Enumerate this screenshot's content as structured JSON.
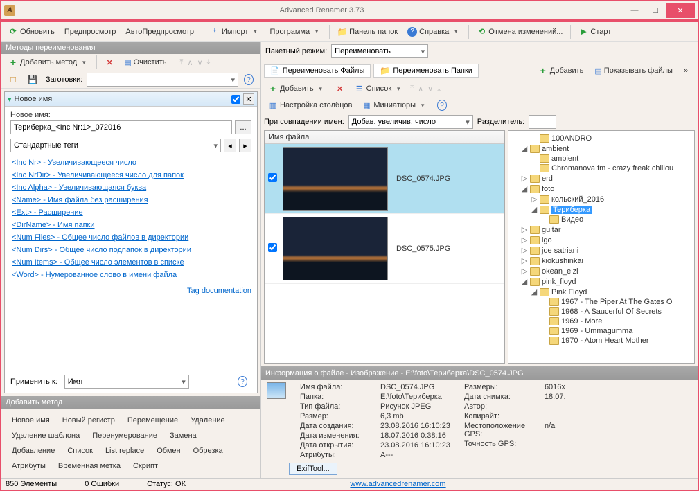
{
  "window": {
    "title": "Advanced Renamer 3.73"
  },
  "winbtns": {
    "min": "—",
    "max": "☐",
    "close": "✕"
  },
  "maintb": {
    "refresh": "Обновить",
    "preview": "Предпросмотр",
    "autopreview": "АвтоПредпросмотр",
    "import": "Импорт",
    "program": "Программа",
    "folderpanel": "Панель папок",
    "help": "Справка",
    "undo": "Отмена изменений...",
    "start": "Старт"
  },
  "left": {
    "hdr_methods": "Методы переименования",
    "add_method": "Добавить метод",
    "clear": "Очистить",
    "presets": "Заготовки:",
    "method_name": "Новое имя",
    "newname_lbl": "Новое имя:",
    "newname_val": "Териберка_<Inc Nr:1>_072016",
    "tags_lbl": "Стандартные теги",
    "tags": [
      "<Inc Nr> - Увеличивающееся число",
      "<Inc NrDir> - Увеличивающееся число для папок",
      "<Inc Alpha> - Увеличивающаяся буква",
      "<Name> - Имя файла без расширения",
      "<Ext> - Расширение",
      "<DirName> - Имя папки",
      "<Num Files> - Общее число файлов в директории",
      "<Num Dirs> - Общее число подпапок в директории",
      "<Num Items> - Общее число элементов в списке",
      "<Word> - Нумерованное слово в имени файла"
    ],
    "tagdoc": "Tag documentation",
    "applyto": "Применить к:",
    "applyto_val": "Имя",
    "hdr_add": "Добавить метод",
    "addm": {
      "r1": [
        "Новое имя",
        "Новый регистр",
        "Перемещение",
        "Удаление"
      ],
      "r2": [
        "Удаление шаблона",
        "Перенумерование",
        "Замена"
      ],
      "r3": [
        "Добавление",
        "Список",
        "List replace",
        "Обмен",
        "Обрезка"
      ],
      "r4": [
        "Атрибуты",
        "Временная метка",
        "Скрипт"
      ]
    }
  },
  "right": {
    "batch_lbl": "Пакетный режим:",
    "batch_val": "Переименовать",
    "tab_files": "Переименовать Файлы",
    "tab_folders": "Переименовать Папки",
    "add": "Добавить",
    "list": "Список",
    "cols": "Настройка столбцов",
    "thumbs": "Миниатюры",
    "collision_lbl": "При совпадении имен:",
    "collision_val": "Добав. увеличив. число",
    "separator_lbl": "Разделитель:",
    "fh_name": "Имя файла",
    "files": [
      "DSC_0574.JPG",
      "DSC_0575.JPG"
    ],
    "tree_add": "Добавить",
    "tree_show": "Показывать файлы",
    "tree": [
      {
        "ind": 2,
        "lbl": "100ANDRO",
        "tgl": ""
      },
      {
        "ind": 1,
        "lbl": "ambient",
        "tgl": "◢"
      },
      {
        "ind": 2,
        "lbl": "ambient",
        "tgl": ""
      },
      {
        "ind": 2,
        "lbl": "Chromanova.fm - crazy freak chillou",
        "tgl": ""
      },
      {
        "ind": 1,
        "lbl": "erd",
        "tgl": "▷"
      },
      {
        "ind": 1,
        "lbl": "foto",
        "tgl": "◢"
      },
      {
        "ind": 2,
        "lbl": "кольский_2016",
        "tgl": "▷"
      },
      {
        "ind": 2,
        "lbl": "Териберка",
        "tgl": "◢",
        "sel": true
      },
      {
        "ind": 3,
        "lbl": "Видео",
        "tgl": ""
      },
      {
        "ind": 1,
        "lbl": "guitar",
        "tgl": "▷"
      },
      {
        "ind": 1,
        "lbl": "igo",
        "tgl": "▷"
      },
      {
        "ind": 1,
        "lbl": "joe satriani",
        "tgl": "▷"
      },
      {
        "ind": 1,
        "lbl": "kiokushinkai",
        "tgl": "▷"
      },
      {
        "ind": 1,
        "lbl": "okean_elzi",
        "tgl": "▷"
      },
      {
        "ind": 1,
        "lbl": "pink_floyd",
        "tgl": "◢"
      },
      {
        "ind": 2,
        "lbl": "Pink Floyd",
        "tgl": "◢"
      },
      {
        "ind": 3,
        "lbl": "1967 - The Piper At The Gates O",
        "tgl": ""
      },
      {
        "ind": 3,
        "lbl": "1968 - A Saucerful Of Secrets",
        "tgl": ""
      },
      {
        "ind": 3,
        "lbl": "1969 - More",
        "tgl": ""
      },
      {
        "ind": 3,
        "lbl": "1969 - Ummagumma",
        "tgl": ""
      },
      {
        "ind": 3,
        "lbl": "1970 - Atom Heart Mother",
        "tgl": ""
      }
    ]
  },
  "info": {
    "hdr": "Информация о файле - Изображение - E:\\foto\\Териберка\\DSC_0574.JPG",
    "left": [
      [
        "Имя файла:",
        "DSC_0574.JPG"
      ],
      [
        "Папка:",
        "E:\\foto\\Териберка"
      ],
      [
        "Тип файла:",
        "Рисунок JPEG"
      ],
      [
        "Размер:",
        "6,3 mb"
      ],
      [
        "Дата создания:",
        "23.08.2016 16:10:23"
      ],
      [
        "Дата изменения:",
        "18.07.2016 0:38:16"
      ],
      [
        "Дата открытия:",
        "23.08.2016 16:10:23"
      ],
      [
        "Атрибуты:",
        "A---"
      ]
    ],
    "right": [
      [
        "Размеры:",
        "6016x"
      ],
      [
        "Дата снимка:",
        "18.07."
      ],
      [
        "Автор:",
        ""
      ],
      [
        "Копирайт:",
        ""
      ],
      [
        "Местоположение GPS:",
        "n/a"
      ],
      [
        "Точность GPS:",
        ""
      ]
    ],
    "exif": "ExifTool..."
  },
  "status": {
    "elements": "850 Элементы",
    "errors": "0 Ошибки",
    "status": "Статус: ОК",
    "url": "www.advancedrenamer.com"
  }
}
